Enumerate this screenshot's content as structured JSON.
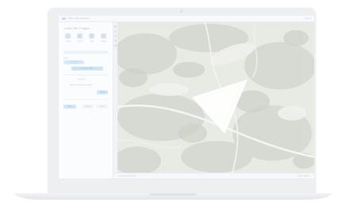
{
  "app": {
    "title": "Plot & Site Analysis",
    "user": "User  ▾"
  },
  "panel": {
    "title": "Create Site / Polygon",
    "tools": [
      {
        "label": "Draw",
        "icon": "polygon-icon"
      },
      {
        "label": "Select",
        "icon": "cursor-icon"
      },
      {
        "label": "Edit",
        "icon": "pencil-icon"
      },
      {
        "label": "Delete",
        "icon": "trash-icon"
      }
    ],
    "area_label": "Area",
    "area_value": "12.4 ha",
    "primary_action": "Analyze Site",
    "secondary_label": "Options",
    "note": "Drag vertices to adjust",
    "apply_label": "Apply",
    "cancel_label": "Cancel",
    "save_label": "Save",
    "next_label": "Next"
  },
  "status": {
    "left": "Lat 0.000  Lon 0.000",
    "right": "Scale 1:5000"
  },
  "colors": {
    "accent": "#cfe3f6",
    "polygon_fill": "#ffffff"
  }
}
